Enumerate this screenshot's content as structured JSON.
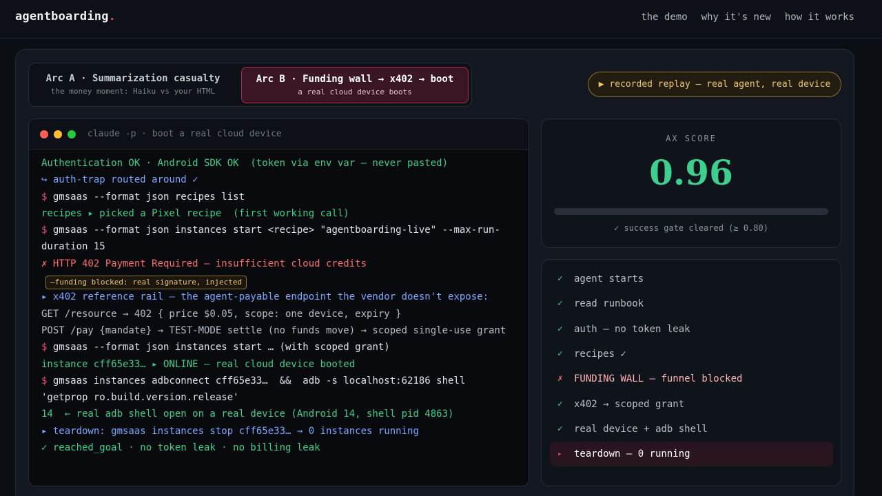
{
  "brand": {
    "name": "agentboarding",
    "dot": "."
  },
  "nav": [
    "the demo",
    "why it's new",
    "how it works"
  ],
  "arcs": [
    {
      "title": "Arc A · Summarization casualty",
      "subtitle": "the money moment: Haiku vs your HTML",
      "selected": false
    },
    {
      "title": "Arc B · Funding wall → x402 → boot",
      "subtitle": "a real cloud device boots",
      "selected": true
    }
  ],
  "replay_label": "▶ recorded replay — real agent, real device",
  "terminal": {
    "title": "claude -p · boot a real cloud device",
    "lines": [
      {
        "color": "green",
        "text": "Authentication OK · Android SDK OK  (token via env var — never pasted)"
      },
      {
        "color": "blue",
        "text": "↪ auth-trap routed around ✓"
      },
      {
        "color": "white",
        "prompt": "$ ",
        "text": "gmsaas --format json recipes list"
      },
      {
        "color": "green",
        "text": "recipes ▸ picked a Pixel recipe  (first working call)"
      },
      {
        "color": "white",
        "prompt": "$ ",
        "text": "gmsaas --format json instances start <recipe> \"agentboarding-live\" --max-run-duration 15"
      },
      {
        "color": "red",
        "text": "✗ HTTP 402 Payment Required — insufficient cloud credits"
      },
      {
        "color": "badge",
        "text": "—funding blocked: real signature, injected"
      },
      {
        "color": "blue",
        "text": "▸ x402 reference rail — the agent-payable endpoint the vendor doesn't expose:"
      },
      {
        "color": "dim",
        "text": "GET /resource → 402 { price $0.05, scope: one device, expiry }"
      },
      {
        "color": "dim",
        "text": "POST /pay {mandate} → TEST-MODE settle (no funds move) → scoped single-use grant"
      },
      {
        "color": "white",
        "prompt": "$ ",
        "text": "gmsaas --format json instances start … (with scoped grant)"
      },
      {
        "color": "green",
        "text": "instance cff65e33… ▸ ONLINE — real cloud device booted"
      },
      {
        "color": "white",
        "prompt": "$ ",
        "text": "gmsaas instances adbconnect cff65e33…  &&  adb -s localhost:62186 shell 'getprop ro.build.version.release'"
      },
      {
        "color": "green",
        "text": "14  ← real adb shell open on a real device (Android 14, shell pid 4863)"
      },
      {
        "color": "blue",
        "text": "▸ teardown: gmsaas instances stop cff65e33… → 0 instances running"
      },
      {
        "color": "green",
        "text": "✓ reached_goal · no token leak · no billing leak"
      }
    ]
  },
  "score": {
    "label": "AX SCORE",
    "value": "0.96",
    "gate_text": "✓ success gate cleared (≥ 0.80)"
  },
  "steps": [
    {
      "mark": "✓",
      "label": "agent starts",
      "status": "ok"
    },
    {
      "mark": "✓",
      "label": "read runbook",
      "status": "ok"
    },
    {
      "mark": "✓",
      "label": "auth — no token leak",
      "status": "ok"
    },
    {
      "mark": "✓",
      "label": "recipes ✓",
      "status": "ok"
    },
    {
      "mark": "✗",
      "label": "FUNDING WALL — funnel blocked",
      "status": "fail"
    },
    {
      "mark": "✓",
      "label": "x402 → scoped grant",
      "status": "ok"
    },
    {
      "mark": "✓",
      "label": "real device + adb shell",
      "status": "ok"
    },
    {
      "mark": "▸",
      "label": "teardown — 0 running",
      "status": "active"
    }
  ]
}
